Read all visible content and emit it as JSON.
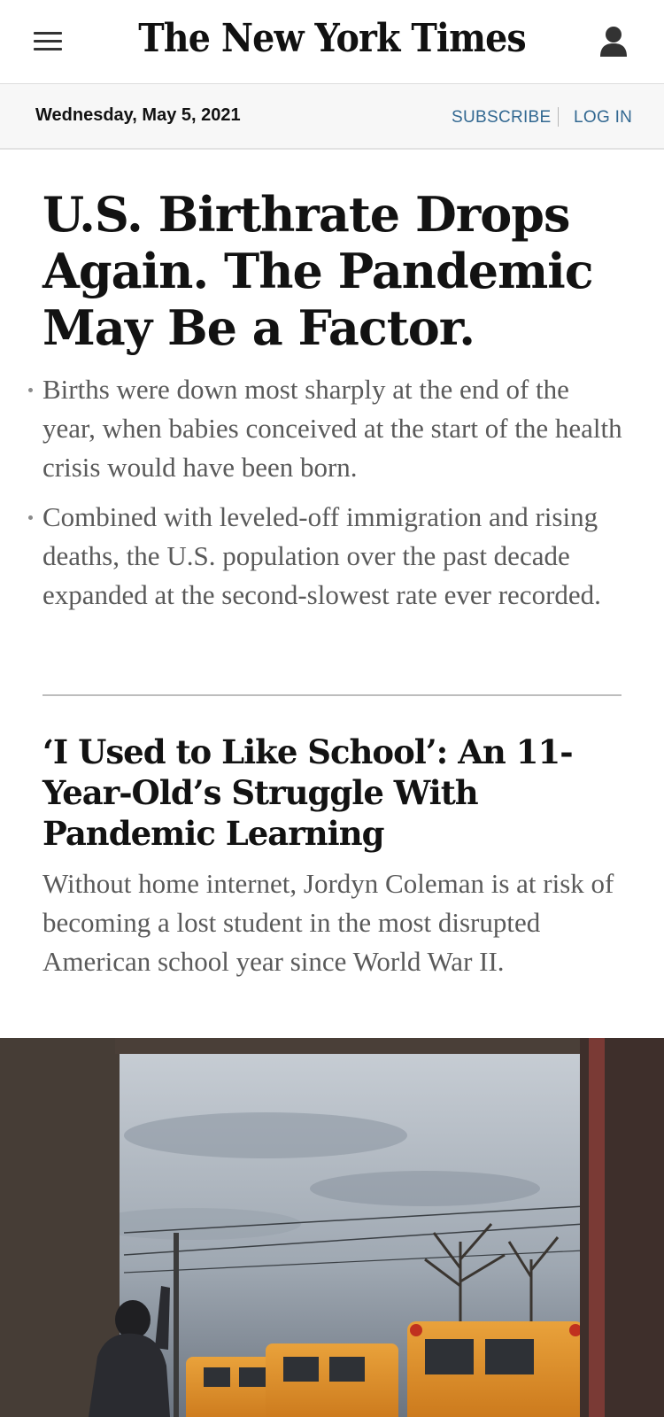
{
  "header": {
    "logo_text": "The New York Times",
    "menu_icon": "hamburger-menu-icon",
    "account_icon": "person-icon"
  },
  "subbar": {
    "date": "Wednesday, May 5, 2021",
    "subscribe_label": "SUBSCRIBE",
    "login_label": "LOG IN"
  },
  "main_story": {
    "headline": "U.S. Birthrate Drops Again. The Pandemic May Be a Factor.",
    "bullets": [
      "Births were down most sharply at the end of the year, when babies conceived at the start of the health crisis would have been born.",
      "Combined with leveled-off immigration and rising deaths, the U.S. population over the past decade expanded at the second-slowest rate ever recorded."
    ]
  },
  "second_story": {
    "headline": "‘I Used to Like School’: An 11-Year-Old’s Struggle With Pandemic Learning",
    "summary": "Without home internet, Jordyn Coleman is at risk of becoming a lost student in the most disrupted American school year since World War II."
  },
  "colors": {
    "link_blue": "#326891",
    "summary_gray": "#5a5a5a",
    "subbar_bg": "#f7f7f7"
  }
}
